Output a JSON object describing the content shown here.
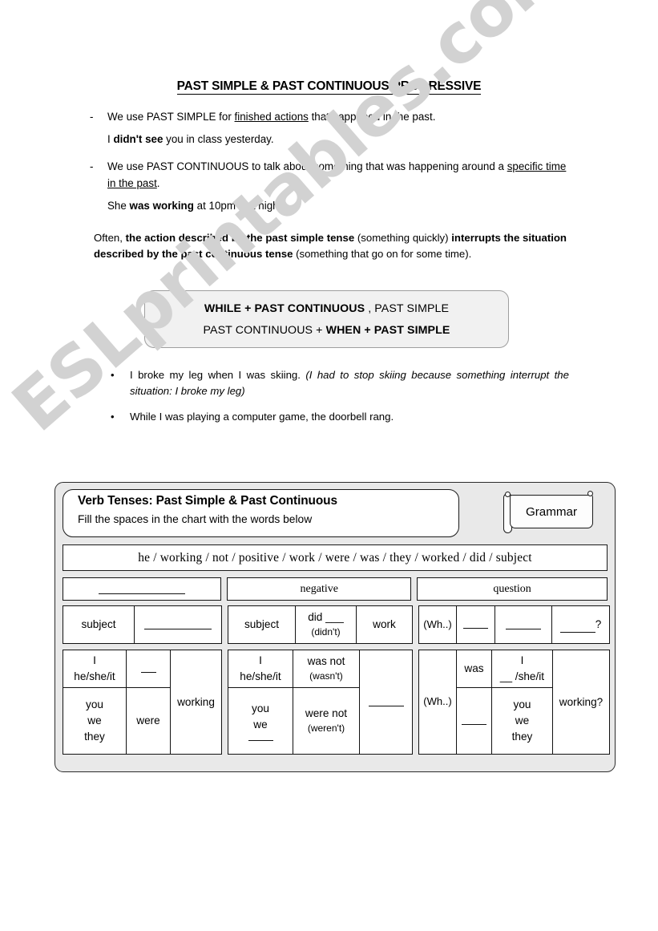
{
  "document": {
    "title": "PAST SIMPLE & PAST CONTINUOUS/PROGRESSIVE",
    "watermark": "ESLprintables.com"
  },
  "rules": [
    {
      "marker": "-",
      "lead": "We use PAST SIMPLE for ",
      "underlined": "finished actions",
      "tail": " that happened in the past.",
      "example_pre": "I ",
      "example_bold": "didn't see",
      "example_post": " you in class yesterday."
    },
    {
      "marker": "-",
      "lead": "We use PAST CONTINUOUS to talk about something that was happening around a ",
      "underlined": "specific time in the past",
      "tail": ".",
      "example_pre": "She ",
      "example_bold": "was working",
      "example_post": " at 10pm last night."
    }
  ],
  "often_paragraph": {
    "p1": "Often, ",
    "b1": "the action described by the past simple tense",
    "p2": " (something quickly) ",
    "b2": "interrupts the situation described by the past continuous tense",
    "p3": " (something that go on for some time)."
  },
  "rule_box": {
    "line1_bold": "WHILE + PAST CONTINUOUS",
    "line1_plain": " , PAST SIMPLE",
    "line2_plain": "PAST CONTINUOUS + ",
    "line2_bold": "WHEN + PAST SIMPLE"
  },
  "examples": [
    {
      "bullet": "•",
      "text": "I broke my leg when I was skiing. ",
      "italic": "(I had to stop skiing because something interrupt the situation: I broke my leg)"
    },
    {
      "bullet": "•",
      "text": "While I was playing a computer game, the doorbell rang.",
      "italic": ""
    }
  ],
  "exercise": {
    "title": "Verb Tenses:  Past Simple & Past Continuous",
    "instruction": "Fill the spaces in the chart with the words below",
    "badge_label": "Grammar",
    "word_bank": "he / working / not / positive / work / were / was / they / worked / did / subject",
    "word_bank_items": [
      "he",
      "working",
      "not",
      "positive",
      "work",
      "were",
      "was",
      "they",
      "worked",
      "did",
      "subject"
    ],
    "headers": {
      "positive": "",
      "negative": "negative",
      "question": "question"
    },
    "formula_row": {
      "positive": [
        "subject",
        ""
      ],
      "negative": [
        "subject",
        "did ___",
        "(didn't)",
        "work"
      ],
      "question": [
        "(Wh..)",
        "",
        "",
        "____?"
      ]
    },
    "continuous_chart": {
      "positive": {
        "subjects_top": [
          "I",
          "he/she/it"
        ],
        "aux_top": "",
        "subjects_bottom": [
          "you",
          "we",
          "they"
        ],
        "aux_bottom": "were",
        "verb": "working"
      },
      "negative": {
        "subjects_top": [
          "I",
          "he/she/it"
        ],
        "aux_top": "was not",
        "aux_top_short": "(wasn't)",
        "subjects_bottom": [
          "you",
          "we",
          ""
        ],
        "aux_bottom": "were not",
        "aux_bottom_short": "(weren't)",
        "verb": ""
      },
      "question": {
        "wh": "(Wh..)",
        "aux_top": "was",
        "aux_bottom": "",
        "subjects_top": [
          "I",
          "__ /she/it"
        ],
        "subjects_bottom": [
          "you",
          "we",
          "they"
        ],
        "verb": "working?"
      }
    }
  }
}
